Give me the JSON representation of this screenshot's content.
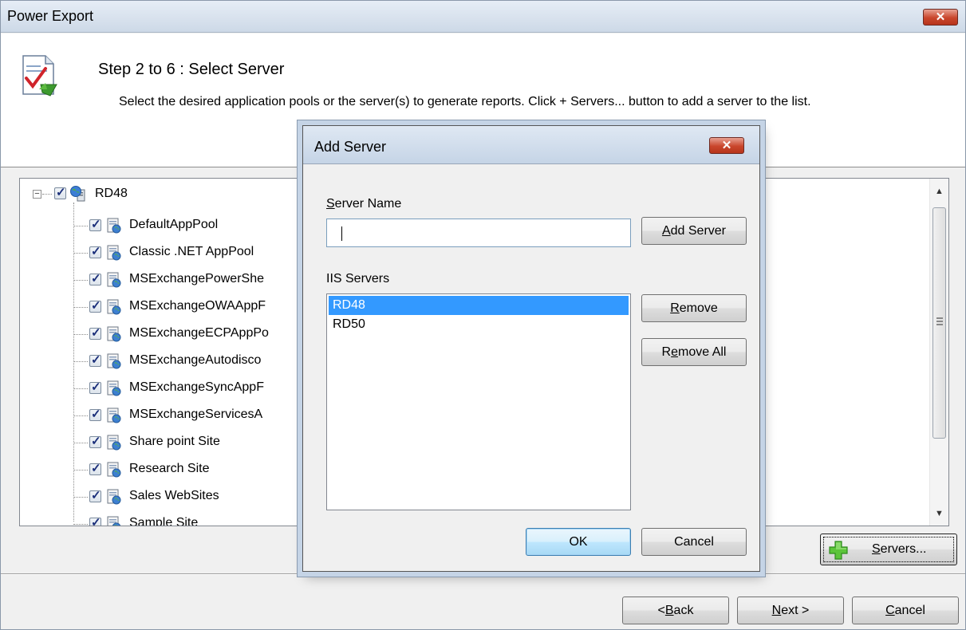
{
  "window": {
    "title": "Power Export",
    "close_glyph": "✕"
  },
  "header": {
    "icon": "report-checklist-icon",
    "step_title": "Step 2 to 6 : Select Server",
    "description": "Select the desired application pools or the server(s) to generate reports. Click + Servers... button to add a server to the list."
  },
  "tree": {
    "root": {
      "label": "RD48",
      "checked": true,
      "expanded": true
    },
    "children": [
      {
        "label": "DefaultAppPool",
        "checked": true
      },
      {
        "label": "Classic .NET AppPool",
        "checked": true
      },
      {
        "label": "MSExchangePowerShe",
        "checked": true
      },
      {
        "label": "MSExchangeOWAAppF",
        "checked": true
      },
      {
        "label": "MSExchangeECPAppPo",
        "checked": true
      },
      {
        "label": "MSExchangeAutodisco",
        "checked": true
      },
      {
        "label": "MSExchangeSyncAppF",
        "checked": true
      },
      {
        "label": "MSExchangeServicesA",
        "checked": true
      },
      {
        "label": "Share point Site",
        "checked": true
      },
      {
        "label": "Research Site",
        "checked": true
      },
      {
        "label": "Sales WebSites",
        "checked": true
      },
      {
        "label": "Sample Site",
        "checked": true
      }
    ]
  },
  "buttons": {
    "servers": {
      "prefix": "+",
      "label_u": "S",
      "label_rest": "ervers..."
    },
    "back": {
      "pre": "<",
      "u": "B",
      "rest": "ack"
    },
    "next": {
      "u": "N",
      "rest": "ext >"
    },
    "cancel": {
      "u": "C",
      "rest": "ancel"
    }
  },
  "dialog": {
    "title": "Add Server",
    "close_glyph": "✕",
    "server_name_label_u": "S",
    "server_name_label_rest": "erver Name",
    "server_name_value": "",
    "add_server_u": "A",
    "add_server_rest": "dd Server",
    "iis_servers_label": "IIS Servers",
    "servers": [
      {
        "name": "RD48",
        "selected": true
      },
      {
        "name": "RD50",
        "selected": false
      }
    ],
    "remove_u": "R",
    "remove_rest": "emove",
    "remove_all_pre": "R",
    "remove_all_u": "e",
    "remove_all_rest": "move All",
    "ok_label": "OK",
    "cancel_label": "Cancel"
  },
  "colors": {
    "selection": "#3399ff",
    "titlebar_top": "#e6edf6",
    "close_red": "#c9462c"
  }
}
